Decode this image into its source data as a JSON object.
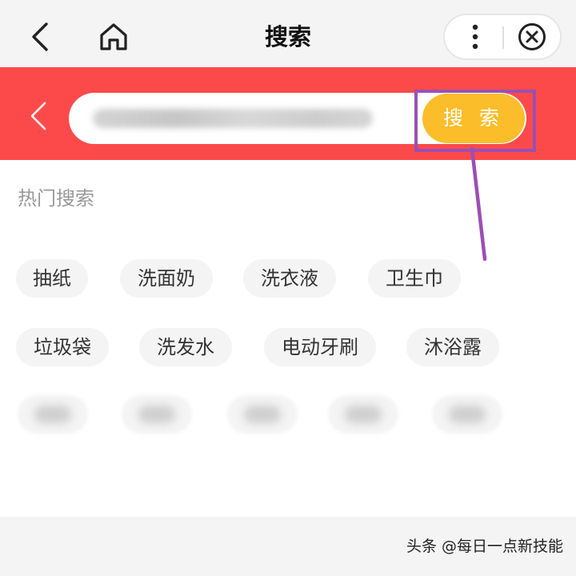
{
  "header": {
    "title": "搜索",
    "back_icon": "chevron-left-icon",
    "home_icon": "home-icon",
    "more_icon": "more-vertical-icon",
    "close_icon": "close-circle-icon"
  },
  "search": {
    "back_icon": "chevron-left-icon",
    "input_value": "",
    "button_label": "搜 索",
    "band_color": "#fc4a4a",
    "button_color": "#fbbd2a",
    "highlight_color": "#9b4fb5"
  },
  "hot_search": {
    "title": "热门搜索",
    "row1": [
      "抽纸",
      "洗面奶",
      "洗衣液",
      "卫生巾"
    ],
    "row2": [
      "垃圾袋",
      "洗发水",
      "电动牙刷",
      "沐浴露"
    ]
  },
  "footer": {
    "watermark": "头条 @每日一点新技能"
  }
}
